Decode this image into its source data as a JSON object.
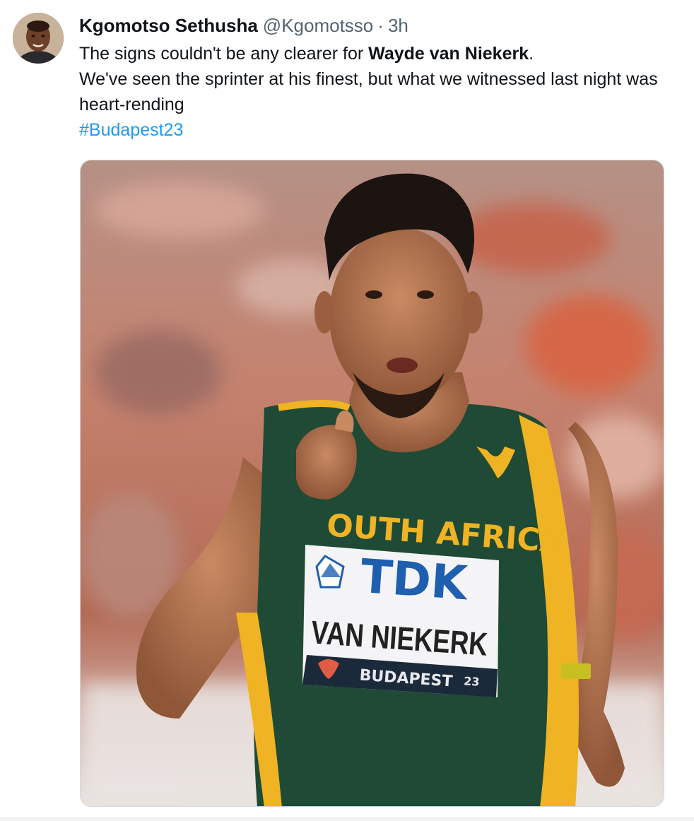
{
  "tweet": {
    "author": {
      "display_name": "Kgomotso Sethusha",
      "handle": "@Kgomotsso",
      "avatar_icon": "user-avatar"
    },
    "separator": "·",
    "time": "3h",
    "text": {
      "line1_prefix": "The signs couldn't be any clearer for ",
      "line1_bold": "Wayde van Niekerk",
      "line1_suffix": ".",
      "line2": "We've seen the sprinter at his finest, but what we witnessed last night was",
      "line3": "heart-rending",
      "hashtag": "#Budapest23"
    },
    "media": {
      "jersey_text": "OUTH AFRICA",
      "bib_sponsor": "TDK",
      "bib_name": "VAN NIEKERK",
      "bib_event": "BUDAPEST",
      "bib_event_number": "23"
    }
  },
  "colors": {
    "link": "#1d9bf0",
    "secondary_text": "#536471",
    "jersey_green": "#1f4a35",
    "jersey_yellow": "#f0b323",
    "bib_blue": "#1f5fb0"
  }
}
